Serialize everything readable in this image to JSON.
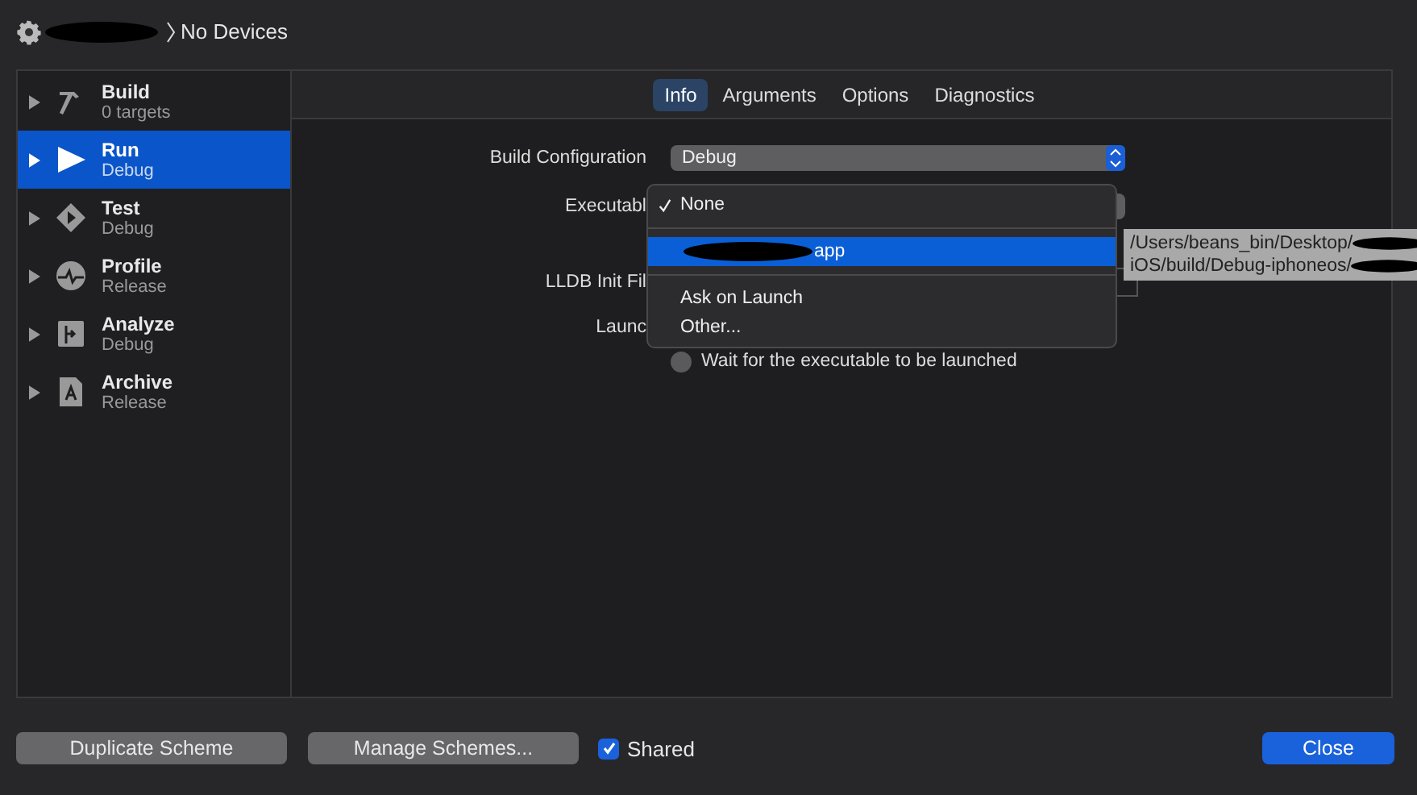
{
  "header": {
    "destination": "No Devices"
  },
  "sidebar": {
    "items": [
      {
        "kind": "build",
        "name": "Build",
        "detail": "0 targets",
        "selected": false
      },
      {
        "kind": "run",
        "name": "Run",
        "detail": "Debug",
        "selected": true
      },
      {
        "kind": "test",
        "name": "Test",
        "detail": "Debug",
        "selected": false
      },
      {
        "kind": "profile",
        "name": "Profile",
        "detail": "Release",
        "selected": false
      },
      {
        "kind": "analyze",
        "name": "Analyze",
        "detail": "Debug",
        "selected": false
      },
      {
        "kind": "archive",
        "name": "Archive",
        "detail": "Release",
        "selected": false
      }
    ]
  },
  "tabs": [
    {
      "label": "Info",
      "selected": true
    },
    {
      "label": "Arguments",
      "selected": false
    },
    {
      "label": "Options",
      "selected": false
    },
    {
      "label": "Diagnostics",
      "selected": false
    }
  ],
  "form": {
    "build_configuration": {
      "label": "Build Configuration",
      "value": "Debug"
    },
    "executable": {
      "label": "Executabl"
    },
    "lldb_init_file": {
      "label": "LLDB Init Fil"
    },
    "launch": {
      "label": "Launc"
    },
    "wait_option": {
      "label": "Wait for the executable to be launched",
      "selected": false
    }
  },
  "executable_menu": {
    "items": [
      {
        "label": "None",
        "checked": true,
        "selected": false,
        "redacted": false,
        "separator_after": true
      },
      {
        "label": "app",
        "checked": false,
        "selected": true,
        "redacted": true,
        "separator_after": true
      },
      {
        "label": "Ask on Launch",
        "checked": false,
        "selected": false,
        "redacted": false,
        "separator_after": false
      },
      {
        "label": "Other...",
        "checked": false,
        "selected": false,
        "redacted": false,
        "separator_after": false
      }
    ]
  },
  "tooltip": {
    "lines": [
      "/Users/beans_bin/Desktop/",
      "iOS/build/Debug-iphoneos/"
    ]
  },
  "footer": {
    "buttons": [
      {
        "label": "Duplicate Scheme",
        "kind": "secondary"
      },
      {
        "label": "Manage Schemes...",
        "kind": "secondary"
      }
    ],
    "shared": {
      "label": "Shared",
      "checked": true
    },
    "close": {
      "label": "Close",
      "kind": "primary"
    }
  }
}
